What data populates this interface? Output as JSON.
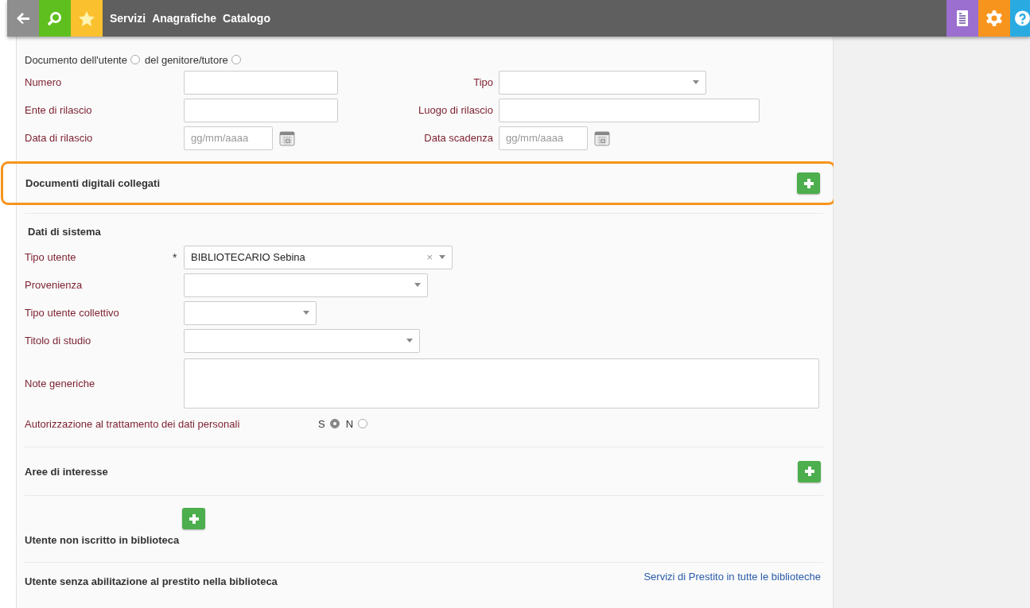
{
  "toolbar": {
    "menu": [
      "Servizi",
      "Anagrafiche",
      "Catalogo"
    ]
  },
  "document_owner": {
    "options": [
      {
        "label": "Documento dell'utente",
        "selected": false
      },
      {
        "label": "del genitore/tutore",
        "selected": false
      }
    ]
  },
  "document_fields": [
    {
      "label": "Numero",
      "kind": "text",
      "right": {
        "label": "Tipo",
        "kind": "select"
      }
    },
    {
      "label": "Ente di rilascio",
      "kind": "text",
      "right": {
        "label": "Luogo di rilascio",
        "kind": "text"
      }
    },
    {
      "label": "Data di rilascio",
      "kind": "date",
      "placeholder": "gg/mm/aaaa",
      "right": {
        "label": "Data scadenza",
        "kind": "date",
        "placeholder": "gg/mm/aaaa"
      }
    }
  ],
  "digital_documents": {
    "title": "Documenti digitali collegati",
    "highlighted": true
  },
  "system_data": {
    "title": "Dati di sistema",
    "fields": [
      {
        "label": "Tipo utente",
        "kind": "select",
        "required_mark": "*",
        "value": "BIBLIOTECARIO Sebina",
        "clear_icon": "×"
      },
      {
        "label": "Provenienza",
        "kind": "select"
      },
      {
        "label": "Tipo utente collettivo",
        "kind": "select"
      },
      {
        "label": "Titolo di studio",
        "kind": "select"
      },
      {
        "label": "Note generiche",
        "kind": "textarea"
      }
    ],
    "consent": {
      "label": "Autorizzazione al trattamento dei dati personali",
      "options": [
        {
          "label": "S",
          "selected": true
        },
        {
          "label": "N",
          "selected": false
        }
      ]
    }
  },
  "sections": [
    {
      "title": "Aree di interesse",
      "kind": "add-right"
    },
    {
      "title": "Utente non iscritto in biblioteca",
      "kind": "add-inline"
    },
    {
      "title": "Utente senza abilitazione al prestito nella biblioteca",
      "kind": "link",
      "link": "Servizi di Prestito in tutte le biblioteche"
    }
  ]
}
